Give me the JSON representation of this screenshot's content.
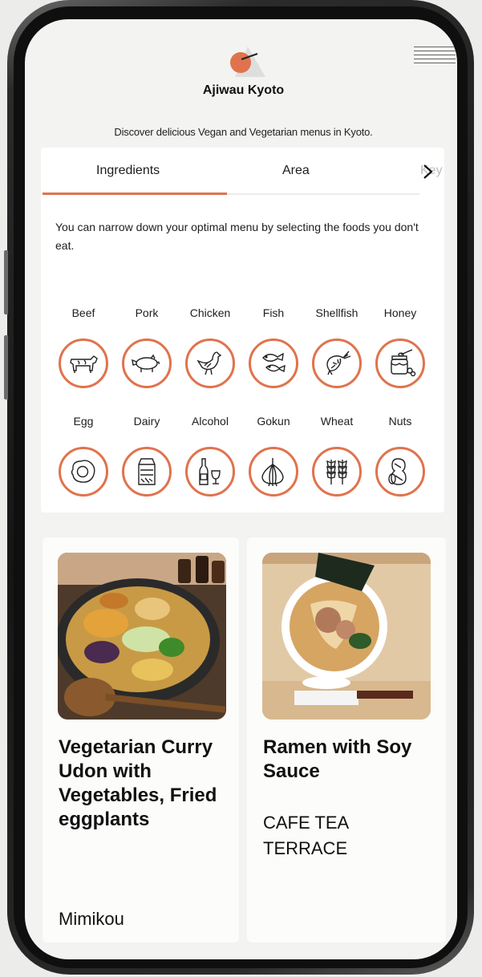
{
  "app": {
    "title": "Ajiwau Kyoto",
    "tagline": "Discover delicious Vegan and Vegetarian menus in Kyoto."
  },
  "tabs": [
    {
      "label": "Ingredients",
      "active": true
    },
    {
      "label": "Area",
      "active": false
    },
    {
      "label": "Key",
      "active": false
    }
  ],
  "ingredients": {
    "description": "You can narrow down your optimal menu by selecting the foods you don't eat.",
    "items": [
      {
        "label": "Beef",
        "icon": "cow-icon"
      },
      {
        "label": "Pork",
        "icon": "pig-icon"
      },
      {
        "label": "Chicken",
        "icon": "chicken-icon"
      },
      {
        "label": "Fish",
        "icon": "fish-icon"
      },
      {
        "label": "Shellfish",
        "icon": "shrimp-icon"
      },
      {
        "label": "Honey",
        "icon": "honey-jar-icon"
      },
      {
        "label": "Egg",
        "icon": "fried-egg-icon"
      },
      {
        "label": "Dairy",
        "icon": "milk-carton-icon"
      },
      {
        "label": "Alcohol",
        "icon": "wine-bottle-icon"
      },
      {
        "label": "Gokun",
        "icon": "garlic-icon"
      },
      {
        "label": "Wheat",
        "icon": "wheat-icon"
      },
      {
        "label": "Nuts",
        "icon": "peanut-icon"
      }
    ]
  },
  "menus": [
    {
      "title": "Vegetarian Curry Udon with Vegetables, Fried eggplants",
      "restaurant": "Mimikou"
    },
    {
      "title": "Ramen with Soy Sauce",
      "restaurant": "CAFE TEA TERRACE"
    }
  ],
  "colors": {
    "accent": "#e0734d",
    "background": "#f3f3f1",
    "panel": "#ffffff"
  }
}
